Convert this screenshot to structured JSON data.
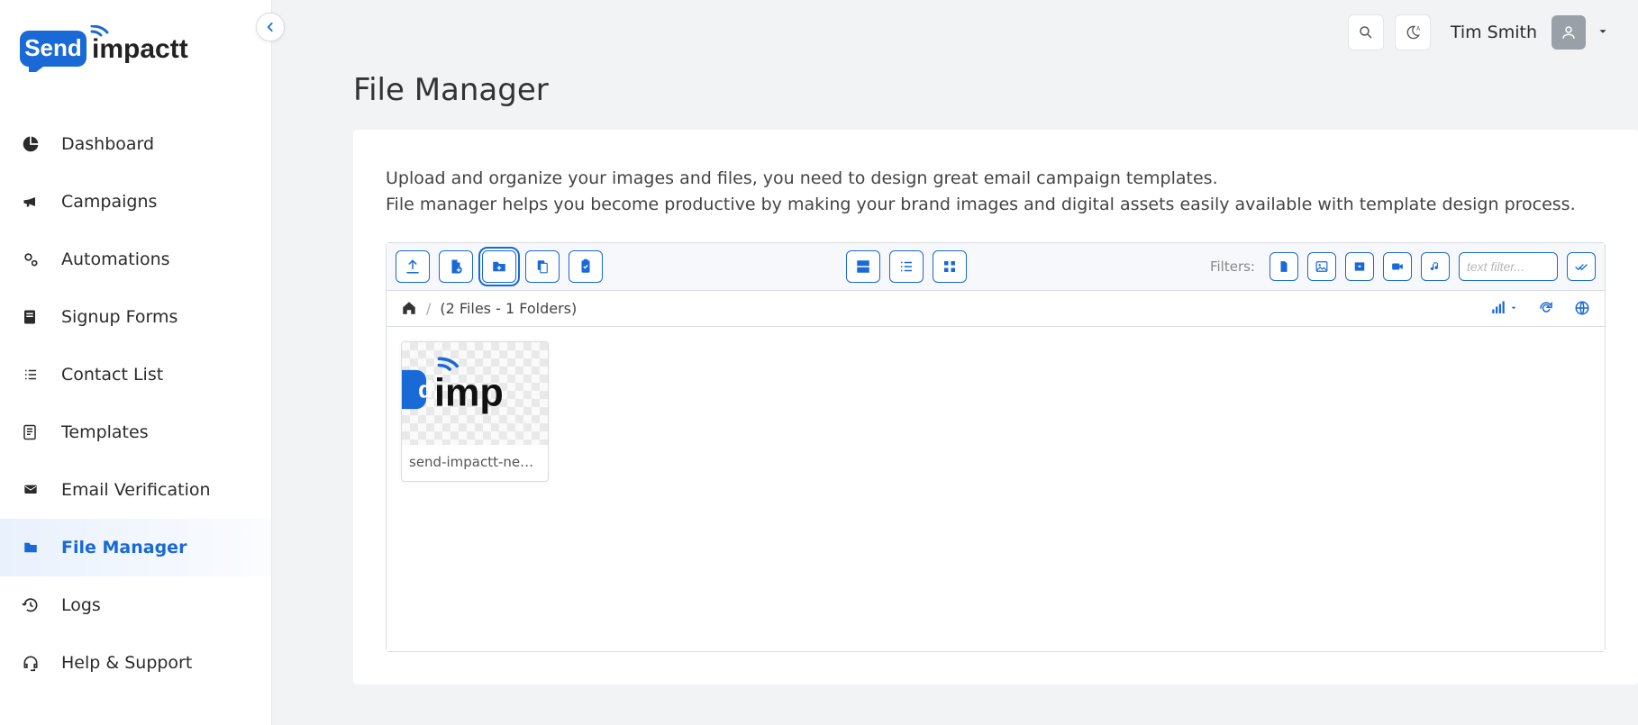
{
  "brand": {
    "part1": "Send",
    "part2": "impactt"
  },
  "user": {
    "name": "Tim Smith"
  },
  "sidebar": {
    "items": [
      {
        "label": "Dashboard",
        "icon": "pie-chart",
        "active": false
      },
      {
        "label": "Campaigns",
        "icon": "bullhorn",
        "active": false
      },
      {
        "label": "Automations",
        "icon": "gears",
        "active": false
      },
      {
        "label": "Signup Forms",
        "icon": "form",
        "active": false
      },
      {
        "label": "Contact List",
        "icon": "list",
        "active": false
      },
      {
        "label": "Templates",
        "icon": "template",
        "active": false
      },
      {
        "label": "Email Verification",
        "icon": "envelope-check",
        "active": false
      },
      {
        "label": "File Manager",
        "icon": "folder",
        "active": true
      },
      {
        "label": "Logs",
        "icon": "history",
        "active": false
      },
      {
        "label": "Help & Support",
        "icon": "headset",
        "active": false
      }
    ]
  },
  "page": {
    "title": "File Manager",
    "desc_line1": "Upload and organize your images and files, you need to design great email campaign templates.",
    "desc_line2": "File manager helps you become productive by making your brand images and digital assets easily available with template design process."
  },
  "fm": {
    "filters_label": "Filters:",
    "filter_placeholder": "text filter...",
    "breadcrumb_info": "(2 Files - 1 Folders)",
    "files": [
      {
        "name": "send-impactt-new_..."
      }
    ]
  }
}
